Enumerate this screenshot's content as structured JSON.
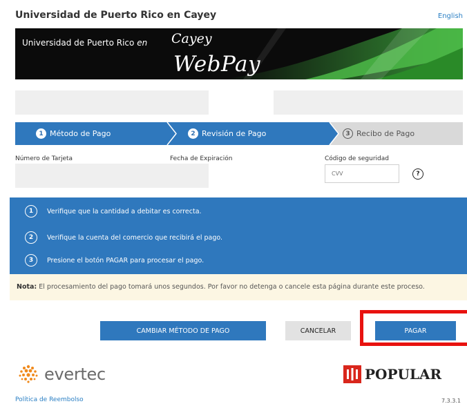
{
  "header": {
    "title": "Universidad de Puerto Rico en Cayey",
    "language_link": "English"
  },
  "banner": {
    "university": "Universidad de Puerto Rico",
    "en": "en",
    "campus": "Cayey",
    "product": "WebPay"
  },
  "steps": [
    {
      "number": "1",
      "label": "Método de Pago",
      "state": "completed"
    },
    {
      "number": "2",
      "label": "Revisión de Pago",
      "state": "active"
    },
    {
      "number": "3",
      "label": "Recibo de Pago",
      "state": "pending"
    }
  ],
  "card": {
    "number_label": "Número de Tarjeta",
    "expiration_label": "Fecha de Expiración",
    "security_label": "Código de seguridad",
    "cvv_placeholder": "CVV"
  },
  "instructions": [
    {
      "number": "1",
      "text": "Verifique que la cantidad a debitar es correcta."
    },
    {
      "number": "2",
      "text": "Verifique la cuenta del comercio que recibirá el pago."
    },
    {
      "number": "3",
      "text": "Presione el botón PAGAR para procesar el pago."
    }
  ],
  "note": {
    "label": "Nota:",
    "text": "El procesamiento del pago tomará unos segundos. Por favor no detenga o cancele esta página durante este proceso."
  },
  "buttons": {
    "change_method": "CAMBIAR MÉTODO DE PAGO",
    "cancel": "CANCELAR",
    "pay": "PAGAR"
  },
  "footer": {
    "evertec": "evertec",
    "popular": "POPULAR",
    "refund_policy": "Política de Reembolso",
    "version": "7.3.3.1"
  },
  "colors": {
    "primary_blue": "#2f78bd",
    "highlight_red": "#e8120f",
    "note_bg": "#fcf6e3",
    "banner_green": "#2c8a2a"
  }
}
